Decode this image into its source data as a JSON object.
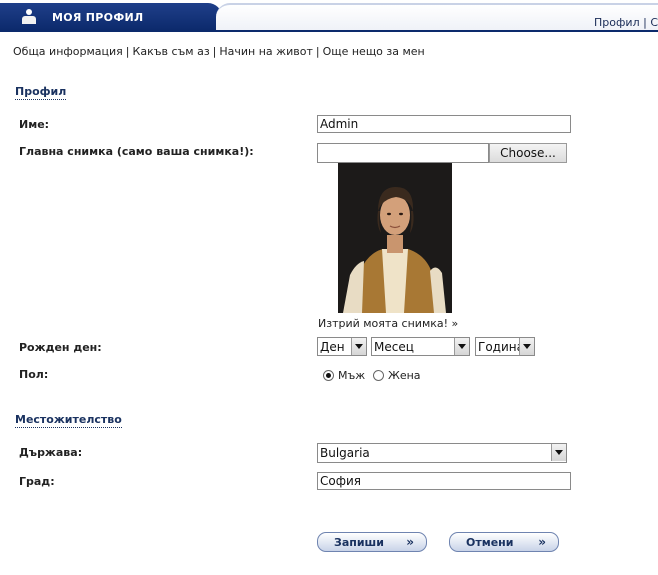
{
  "header": {
    "title": "МОЯ ПРОФИЛ",
    "links": [
      "Профил",
      "С"
    ]
  },
  "subnav": {
    "items": [
      "Обща информация",
      "Какъв съм аз",
      "Начин на живот",
      "Още нещо за мен"
    ]
  },
  "profile": {
    "section_title": "Профил",
    "name_label": "Име:",
    "name_value": "Admin",
    "photo_label": "Главна снимка (само ваша снимка!):",
    "choose_label": "Choose...",
    "delete_photo_link": "Изтрий моята снимка! »",
    "birthday_label": "Рожден ден:",
    "birthday_day": "Ден",
    "birthday_month": "Месец",
    "birthday_year": "Година",
    "gender_label": "Пол:",
    "gender_male": "Мъж",
    "gender_female": "Жена",
    "gender_selected": "Мъж"
  },
  "residence": {
    "section_title": "Местожителство",
    "country_label": "Държава:",
    "country_value": "Bulgaria",
    "city_label": "Град:",
    "city_value": "София"
  },
  "actions": {
    "save_label": "Запиши",
    "cancel_label": "Отмени",
    "arrow": "»"
  },
  "colors": {
    "header_blue": "#0c2a6c",
    "section_title": "#1a3260"
  }
}
